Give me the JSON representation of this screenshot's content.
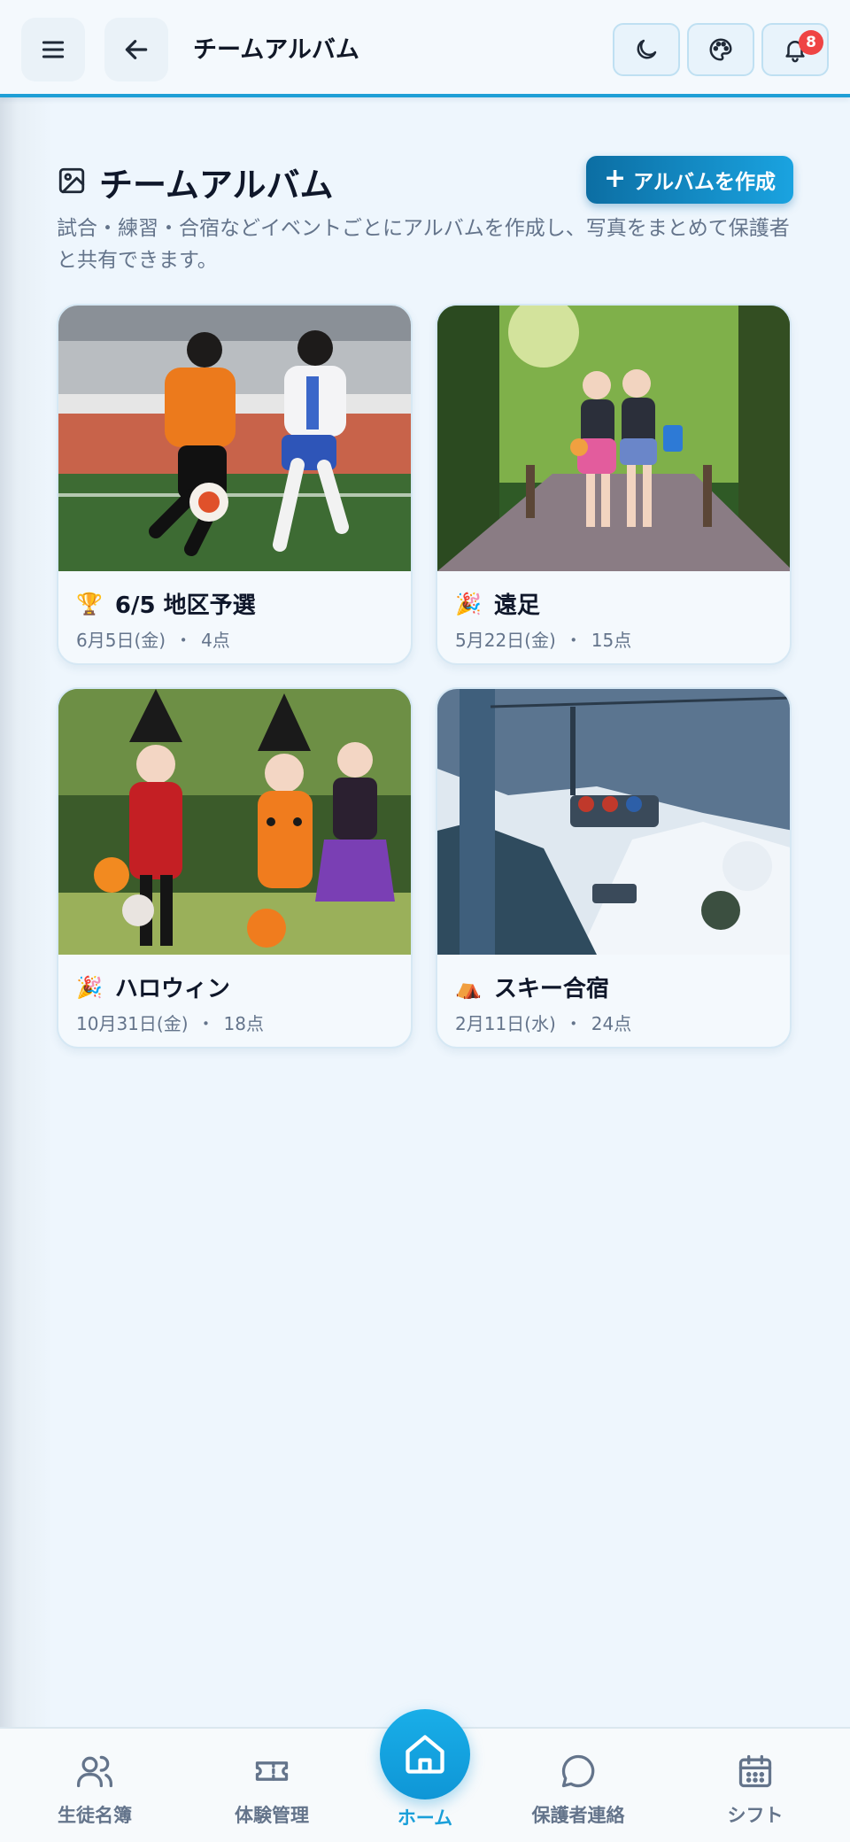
{
  "header": {
    "title": "チームアルバム",
    "notification_count": "8"
  },
  "page": {
    "title": "チームアルバム",
    "create_label": "アルバムを作成",
    "create_plus": "+",
    "description": "試合・練習・合宿などイベントごとにアルバムを作成し、写真をまとめて保護者と共有できます。"
  },
  "albums": [
    {
      "emoji": "🏆",
      "title": "6/5 地区予選",
      "date": "6月5日(金)",
      "count": "4点"
    },
    {
      "emoji": "🎉",
      "title": "遠足",
      "date": "5月22日(金)",
      "count": "15点"
    },
    {
      "emoji": "🎉",
      "title": "ハロウィン",
      "date": "10月31日(金)",
      "count": "18点"
    },
    {
      "emoji": "⛺",
      "title": "スキー合宿",
      "date": "2月11日(水)",
      "count": "24点"
    }
  ],
  "meta_separator": "・",
  "nav": {
    "students": "生徒名簿",
    "trial": "体験管理",
    "home": "ホーム",
    "parents": "保護者連絡",
    "shift": "シフト"
  },
  "colors": {
    "accent": "#1a9fd9",
    "badge": "#ef4444",
    "text_muted": "#64748b"
  }
}
